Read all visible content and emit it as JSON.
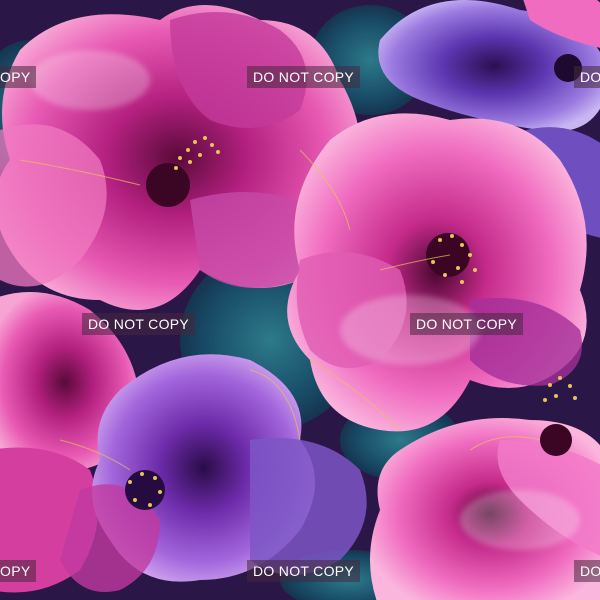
{
  "image": {
    "subject": "alcohol-ink style hibiscus flowers",
    "palette": {
      "magenta": "#c0268f",
      "pink": "#f06cc0",
      "violet": "#8a3fc8",
      "deep_purple": "#3b145e",
      "teal": "#1d5a72",
      "gold": "#e8c25a"
    }
  },
  "watermark": {
    "text": "DO NOT COPY",
    "partial_left": "OPY",
    "partial_right": "DO",
    "partial_left_bottom": "OPY",
    "partial_right_bottom": "DO"
  }
}
